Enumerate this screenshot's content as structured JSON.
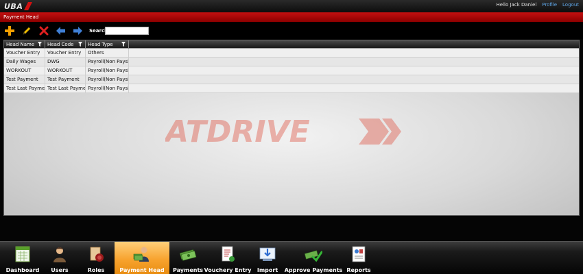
{
  "header": {
    "logo_text": "UBA",
    "greeting": "Hello Jack Daniel",
    "profile_link": "Profile",
    "logout_link": "Logout"
  },
  "titlebar": {
    "title": "Payment Head"
  },
  "toolbar": {
    "buttons": [
      "add-icon",
      "edit-icon",
      "delete-icon",
      "back-arrow-icon",
      "forward-arrow-icon"
    ],
    "search_label": "Search",
    "search_value": "",
    "search_placeholder": ""
  },
  "grid": {
    "columns": [
      "Head Name",
      "Head Code",
      "Head Type"
    ],
    "rows": [
      [
        "Voucher Entry",
        "Voucher Entry",
        "Others"
      ],
      [
        "Daily Wages",
        "DWG",
        "Payroll(Non Payslip)"
      ],
      [
        "WORKOUT",
        "WORKOUT",
        "Payroll(Non Payslip)"
      ],
      [
        "Test Payment",
        "Test Payment",
        "Payroll(Non Payslip)"
      ],
      [
        "Test Last Payment",
        "Test Last Payment",
        "Payroll(Non Payslip)"
      ]
    ]
  },
  "watermark": {
    "text": "ATDRIVE"
  },
  "dock": {
    "items": [
      {
        "label": "Dashboard",
        "icon": "dashboard-icon"
      },
      {
        "label": "Users",
        "icon": "users-icon"
      },
      {
        "label": "Roles",
        "icon": "roles-icon"
      },
      {
        "label": "Payment Head",
        "icon": "payment-head-icon"
      },
      {
        "label": "Payments",
        "icon": "payments-icon"
      },
      {
        "label": "Vouchery Entry",
        "icon": "voucher-entry-icon"
      },
      {
        "label": "Import",
        "icon": "import-icon"
      },
      {
        "label": "Approve Payments",
        "icon": "approve-payments-icon"
      },
      {
        "label": "Reports",
        "icon": "reports-icon"
      }
    ],
    "active": "Payment Head"
  },
  "colors": {
    "accent_red": "#b30000",
    "active_orange": "#f7a22d",
    "link_blue": "#5ea6e8"
  }
}
